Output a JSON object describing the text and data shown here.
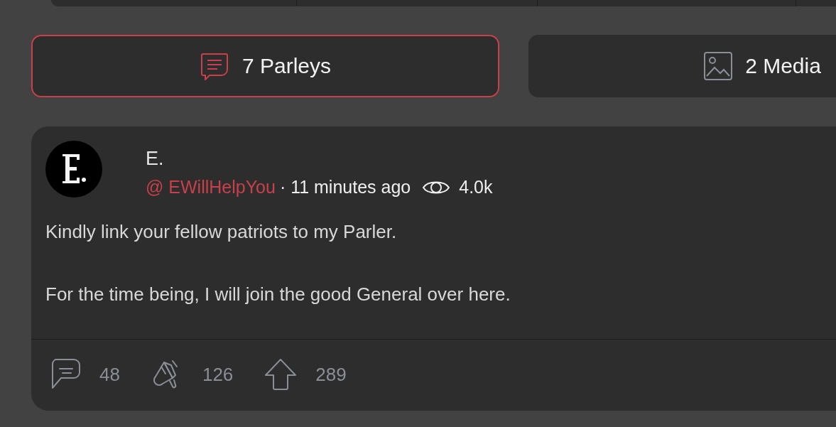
{
  "tabs": [
    {
      "kind": "parleys",
      "label": "7 Parleys",
      "selected": true
    },
    {
      "kind": "media",
      "label": "2 Media",
      "selected": false
    }
  ],
  "post": {
    "author": {
      "name": "E.",
      "handle": "@ EWillHelpYou",
      "time": "· 11 minutes ago",
      "views": "4.0k"
    },
    "paragraphs": [
      "Kindly link your fellow patriots to my Parler.",
      "For the time being, I will join the good General over here."
    ],
    "actions": [
      {
        "kind": "comment",
        "count": "48"
      },
      {
        "kind": "echo",
        "count": "126"
      },
      {
        "kind": "upvote",
        "count": "289"
      }
    ]
  }
}
